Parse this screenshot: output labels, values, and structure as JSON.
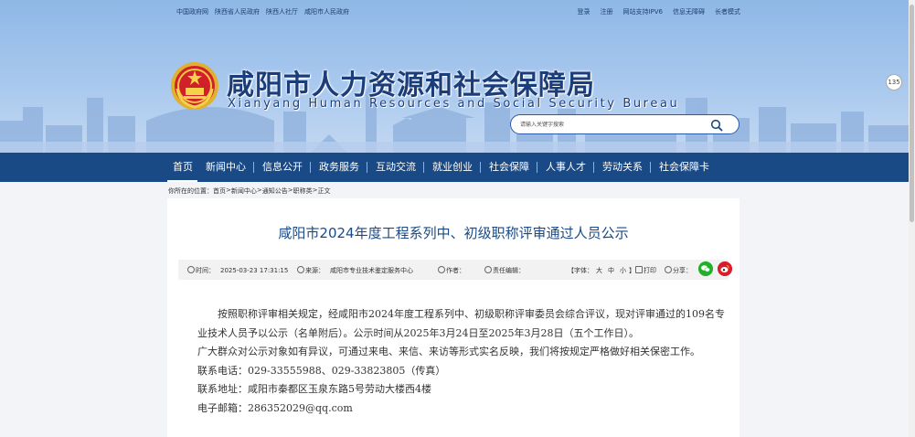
{
  "topbar": {
    "left_links": [
      "中国政府网",
      "陕西省人民政府",
      "陕西人社厅",
      "咸阳市人民政府"
    ],
    "right_links": [
      "登录",
      "注册",
      "网站支持IPV6",
      "信息无障碍",
      "长者模式"
    ]
  },
  "header": {
    "title": "咸阳市人力资源和社会保障局",
    "subtitle": "Xianyang Human Resources and Social Security Bureau"
  },
  "search": {
    "placeholder": "请输入关键字搜索"
  },
  "nav": {
    "items": [
      "首页",
      "新闻中心",
      "信息公开",
      "政务服务",
      "互动交流",
      "就业创业",
      "社会保障",
      "人事人才",
      "劳动关系",
      "社会保障卡"
    ]
  },
  "breadcrumb": {
    "label": "你所在的位置：",
    "items": [
      "首页",
      "新闻中心",
      "通知公告",
      "职称类",
      "正文"
    ],
    "separator": " > "
  },
  "article": {
    "title": "咸阳市2024年度工程系列中、初级职称评审通过人员公示",
    "meta": {
      "time_label": "时间：",
      "time": "2025-03-23 17:31:15",
      "source_label": "来源：",
      "source": "咸阳市专业技术鉴定服务中心",
      "author_label": "作者：",
      "editor_label": "责任编辑：",
      "font_label": "【字体：",
      "font_large": "大",
      "font_medium": "中",
      "font_small": "小",
      "font_end": "】",
      "print": "打印",
      "share": "分享："
    },
    "paragraphs": [
      "按照职称评审相关规定，经咸阳市2024年度工程系列中、初级职称评审委员会综合评议，现对评审通过的109名专业技术人员予以公示（名单附后）。公示时间从2025年3月24日至2025年3月28日（五个工作日）。",
      "广大群众对公示对象如有异议，可通过来电、来信、来访等形式实名反映，我们将按规定严格做好相关保密工作。",
      "联系电话：029-33555988、029-33823805（传真）",
      "联系地址：咸阳市秦都区玉泉东路5号劳动大楼西4楼",
      "电子邮箱：286352029@qq.com"
    ]
  },
  "side": {
    "badge": "135"
  },
  "colors": {
    "nav_bg": "#1a4a85",
    "title_color": "#1a4a85",
    "header_sky": "#a8c8ee"
  }
}
